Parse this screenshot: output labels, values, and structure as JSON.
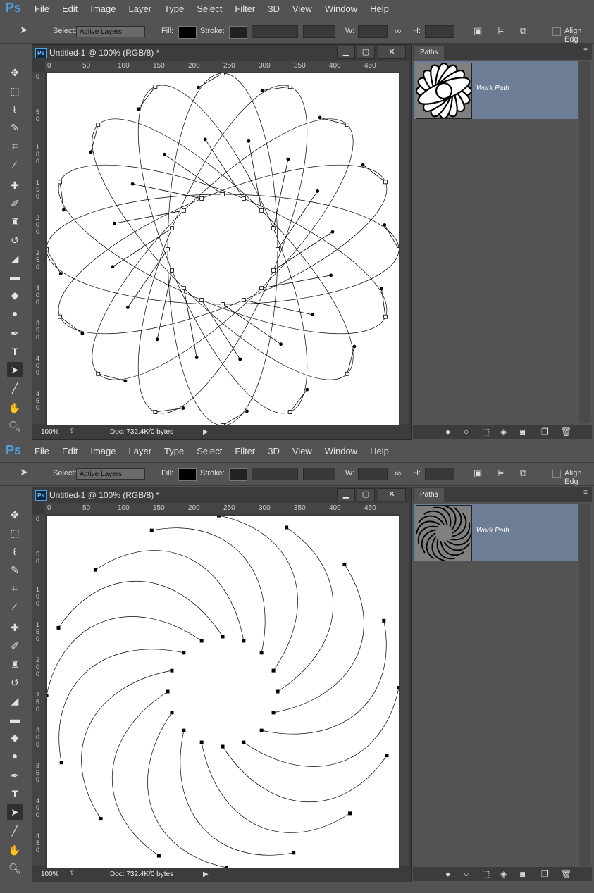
{
  "app_logo": "Ps",
  "menu": [
    "File",
    "Edit",
    "Image",
    "Layer",
    "Type",
    "Select",
    "Filter",
    "3D",
    "View",
    "Window",
    "Help"
  ],
  "options": {
    "select_label": "Select:",
    "select_value": "Active Layers",
    "fill_label": "Fill:",
    "stroke_label": "Stroke:",
    "w_label": "W:",
    "h_label": "H:",
    "align_label": "Align Edg"
  },
  "document": {
    "title": "Untitled-1 @ 100% (RGB/8) *",
    "zoom": "100%",
    "doc_info": "Doc: 732.4K/0 bytes",
    "ruler_top": [
      "0",
      "50",
      "100",
      "150",
      "200",
      "250",
      "300",
      "350",
      "400",
      "450"
    ],
    "ruler_left": [
      "0",
      "50",
      "100",
      "150",
      "200",
      "250",
      "300",
      "350",
      "400",
      "450"
    ]
  },
  "panel": {
    "tab": "Paths",
    "path_name": "Work Path"
  },
  "colors": {
    "selection": "#6c7d95",
    "ui_bg": "#535353",
    "dark": "#3c3c3c"
  }
}
